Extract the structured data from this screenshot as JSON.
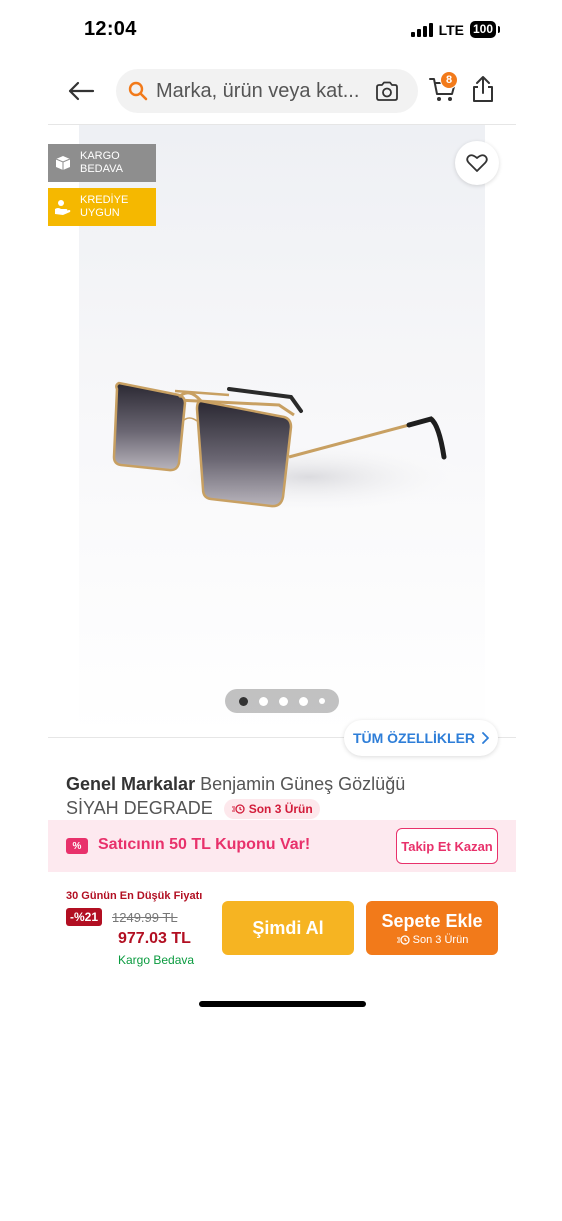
{
  "status_bar": {
    "time": "12:04",
    "network": "LTE",
    "battery": "100"
  },
  "header": {
    "search_placeholder": "Marka, ürün veya kategori ara",
    "search_display": "Marka, ürün veya kat...",
    "cart_count": "8",
    "icons": [
      "back-arrow-icon",
      "search-icon",
      "camera-icon",
      "cart-icon",
      "share-icon"
    ]
  },
  "gallery": {
    "badges": {
      "cargo_line1": "KARGO",
      "cargo_line2": "BEDAVA",
      "credit_line1": "KREDİYE",
      "credit_line2": "UYGUN"
    },
    "dot_count": 5,
    "active_dot": 1,
    "all_features_label": "TÜM ÖZELLİKLER"
  },
  "product": {
    "brand": "Genel Markalar",
    "name": "Benjamin Güneş Gözlüğü",
    "variant": "SİYAH DEGRADE",
    "stock_label": "Son 3 Ürün"
  },
  "coupon": {
    "icon_text": "%",
    "text": "Satıcının 50 TL Kuponu Var!",
    "follow_label": "Takip Et Kazan"
  },
  "pricing": {
    "lowest_label": "30 Günün En Düşük Fiyatı",
    "discount": "-%21",
    "old_price": "1249.99 TL",
    "new_price": "977.03 TL",
    "free_cargo": "Kargo Bedava"
  },
  "actions": {
    "buy_now": "Şimdi Al",
    "add_to_cart": "Sepete Ekle",
    "add_to_cart_sub": "Son 3 Ürün"
  },
  "colors": {
    "brand_orange": "#f27a1a",
    "buy_yellow": "#f6b422",
    "price_red": "#b20f22",
    "coupon_pink": "#e8316b",
    "green": "#0a9b3f",
    "link_blue": "#2e7ed8"
  }
}
